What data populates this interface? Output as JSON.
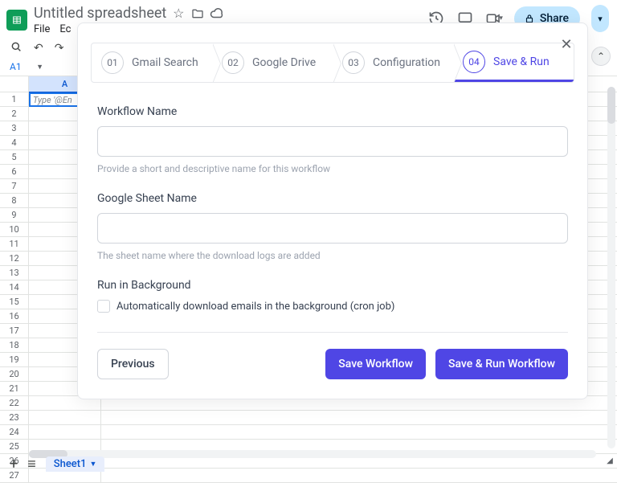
{
  "sheets": {
    "title": "Untitled spreadsheet",
    "menu": {
      "file": "File",
      "edit_truncated": "Ec"
    },
    "share": "Share",
    "namebox": "A1",
    "col_a_header": "A",
    "cell_a1_placeholder": "Type '@En",
    "rows": [
      "1",
      "2",
      "3",
      "4",
      "5",
      "6",
      "7",
      "8",
      "9",
      "10",
      "11",
      "12",
      "13",
      "14",
      "15",
      "16",
      "17",
      "18",
      "19",
      "20",
      "21",
      "22",
      "23",
      "24",
      "25",
      "26",
      "27"
    ],
    "sheet_tab": "Sheet1"
  },
  "modal": {
    "steps": [
      {
        "num": "01",
        "label": "Gmail Search"
      },
      {
        "num": "02",
        "label": "Google Drive"
      },
      {
        "num": "03",
        "label": "Configuration"
      },
      {
        "num": "04",
        "label": "Save & Run"
      }
    ],
    "workflow_name": {
      "label": "Workflow Name",
      "value": "",
      "help": "Provide a short and descriptive name for this workflow"
    },
    "sheet_name": {
      "label": "Google Sheet Name",
      "value": "",
      "help": "The sheet name where the download logs are added"
    },
    "background": {
      "label": "Run in Background",
      "checkbox_label": "Automatically download emails in the background (cron job)"
    },
    "buttons": {
      "previous": "Previous",
      "save": "Save Workflow",
      "save_run": "Save & Run Workflow"
    }
  }
}
